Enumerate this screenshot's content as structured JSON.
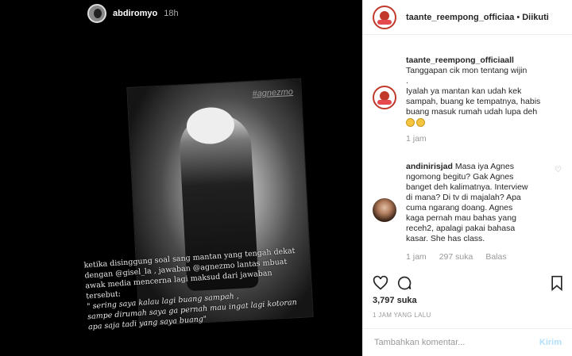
{
  "story": {
    "username": "abdiromyo",
    "time": "18h",
    "photo_tag": "#agnezmo",
    "caption": [
      "ketika disinggung soal sang mantan yang tengah dekat",
      "dengan @gisel_la , jawaban @agnezmo lantas mbuat",
      "awak media mencerna lagi maksud dari jawaban",
      "tersebut:"
    ],
    "quote": [
      "\" sering saya kalau lagi buang sampah ,",
      "sampe dirumah saya ga pernah mau ingat lagi kotoran",
      "apa saja tadi yang saya buang\""
    ]
  },
  "post": {
    "username": "taante_reempong_officiaa",
    "separator": "•",
    "follow_label": "Diikuti"
  },
  "comments": [
    {
      "username": "taante_reempong_officiaall",
      "lines": [
        "Tanggapan cik mon tentang wijin",
        ".",
        "Iyalah ya mantan kan udah kek",
        "sampah, buang ke tempatnya, habis",
        "buang masuk rumah udah lupa deh"
      ],
      "time": "1 jam"
    },
    {
      "username": "andinirisjad",
      "lines": [
        "Masa iya Agnes",
        "ngomong begitu? Gak Agnes",
        "banget deh kalimatnya. Interview",
        "di mana? Di tv di majalah? Apa",
        "cuma ngarang doang. Agnes",
        "kaga pernah mau bahas yang",
        "receh2, apalagi pakai bahasa",
        "kasar. She has class."
      ],
      "time": "1 jam",
      "likes": "297 suka",
      "reply": "Balas"
    }
  ],
  "footer": {
    "likes": "3,797 suka",
    "time_ago": "1 JAM YANG LALU",
    "comment_placeholder": "Tambahkan komentar...",
    "post_label": "Kirim"
  }
}
